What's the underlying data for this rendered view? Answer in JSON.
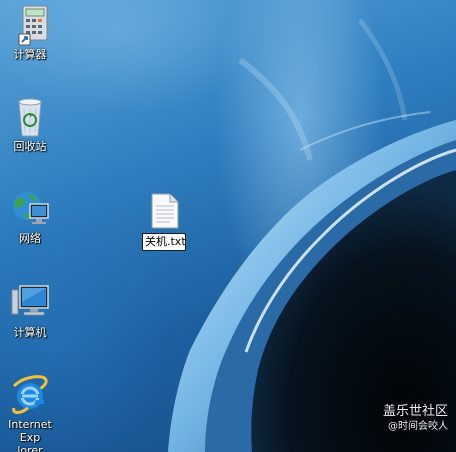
{
  "desktop": {
    "icons": [
      {
        "label": "计算器",
        "icon": "calculator-icon"
      },
      {
        "label": "回收站",
        "icon": "recycle-bin-icon"
      },
      {
        "label": "网络",
        "icon": "network-icon"
      },
      {
        "label": "计算机",
        "icon": "computer-icon"
      },
      {
        "label": "Internet Exp lorer",
        "label_line1": "Internet Exp",
        "label_line2": "lorer",
        "icon": "internet-explorer-icon"
      }
    ],
    "file": {
      "icon": "text-file-icon",
      "rename_value": "关机.txt"
    }
  },
  "watermark": {
    "line1": "盖乐世社区",
    "line2": "@时间会咬人"
  },
  "colors": {
    "wallpaper": "#2f7fc0",
    "rename_border": "#1a1a1a",
    "label_text": "#ffffff"
  }
}
